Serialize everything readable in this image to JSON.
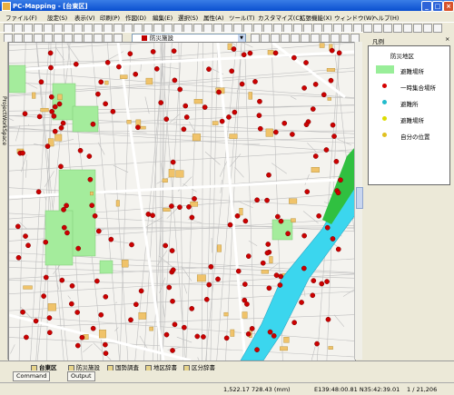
{
  "window": {
    "title": "PC-Mapping - [台東区]"
  },
  "menu": [
    "ファイル(F)",
    "設定(S)",
    "表示(V)",
    "印刷(P)",
    "作図(D)",
    "編集(E)",
    "選択(S)",
    "属性(A)",
    "ツール(T)",
    "カスタマイズ(C)",
    "拡張機能(X)",
    "ウィンドウ(W)",
    "ヘルプ(H)"
  ],
  "toolbar": {
    "layer_select": "防災施設"
  },
  "sidebar": {
    "tab_label": "ProjectWorkSpace"
  },
  "legend": {
    "header": "凡例",
    "title": "防災地区",
    "items": [
      {
        "label": "避難場所",
        "symbol": "green-rect",
        "color": "#99ee99"
      },
      {
        "label": "一時集合場所",
        "symbol": "red-dot",
        "color": "#d40000"
      },
      {
        "label": "避難所",
        "symbol": "cyan-dot",
        "color": "#22bbcc"
      },
      {
        "label": "避難場所",
        "symbol": "yellow-dot",
        "color": "#dddd00"
      },
      {
        "label": "自分の位置",
        "symbol": "yellow-dot",
        "color": "#e0c020"
      }
    ]
  },
  "tabs": [
    "台東区",
    "防災施設",
    "国勢調査",
    "地区辞書",
    "区分辞書"
  ],
  "command": {
    "command_label": "Command",
    "output_label": "Output"
  },
  "status": {
    "coords": "1,522.17  728.43 (mm)",
    "latlon": "E139:48:00.81 N35:42:39.01",
    "scale": "1 / 21,206"
  }
}
